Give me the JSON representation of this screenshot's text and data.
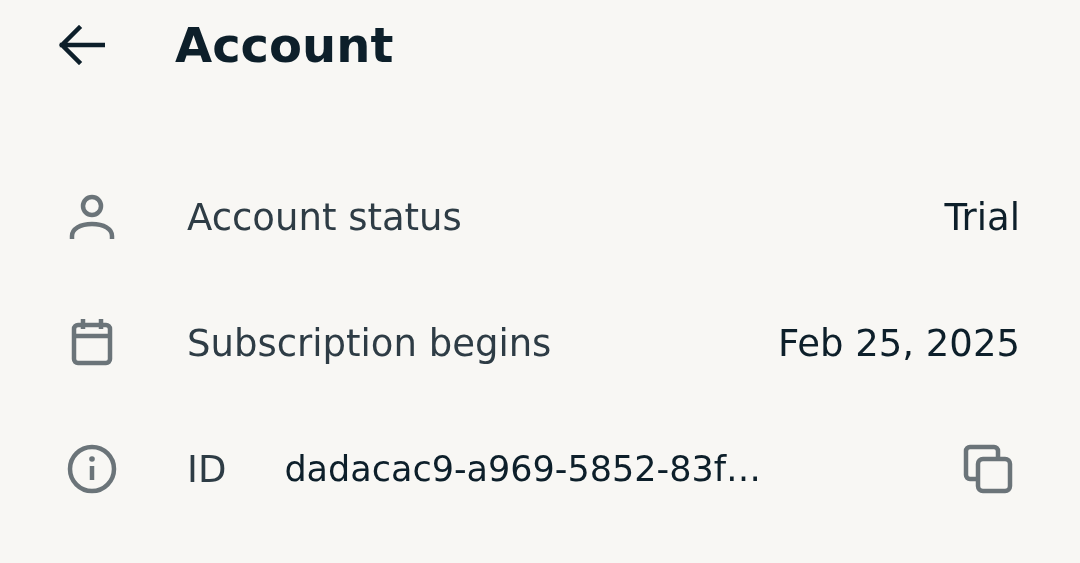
{
  "header": {
    "title": "Account"
  },
  "rows": [
    {
      "kind": "text",
      "label": "Account status",
      "value": "Trial"
    },
    {
      "kind": "text",
      "label": "Subscription begins",
      "value": "Feb 25, 2025"
    },
    {
      "kind": "copyable",
      "label": "ID",
      "value": "dadacac9-a969-5852-83f…"
    }
  ]
}
